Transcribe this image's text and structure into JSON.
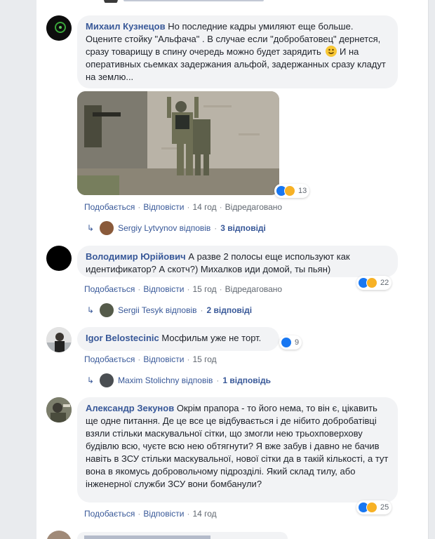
{
  "colors": {
    "link": "#385898",
    "meta": "#606770",
    "bubble": "#f2f3f5",
    "like": "#1877f2",
    "haha": "#f7b125"
  },
  "comments": [
    {
      "author": "Михаил Кузнецов",
      "text_1": "Но последние кадры умиляют еще больше. Оцените стойку \"Альфача\" . В случае если \"добробатовец\" дернется, сразу товарищу в спину очередь можно будет зарядить",
      "text_2": " И на оперативных сьемках задержания альфой, задержанных сразу кладут на землю...",
      "reactions": "13",
      "like": "Подобається",
      "reply": "Відповісти",
      "time": "14 год",
      "edited": "Відредаговано",
      "replies_by": "Sergiy Lytvynov відповів",
      "replies_count": "3 відповіді"
    },
    {
      "author": "Володимир Юрійович",
      "text": "А разве 2 полосы еще используют как идентификатор? А скотч?) Михалков иди домой, ты пьян)",
      "reactions": "22",
      "like": "Подобається",
      "reply": "Відповісти",
      "time": "15 год",
      "edited": "Відредаговано",
      "replies_by": "Sergii Tesyk відповів",
      "replies_count": "2 відповіді"
    },
    {
      "author": "Igor Belostecinic",
      "text": "Мосфильм уже не торт.",
      "reactions": "9",
      "like": "Подобається",
      "reply": "Відповісти",
      "time": "15 год",
      "replies_by": "Maxim Stolichny відповів",
      "replies_count": "1 відповідь"
    },
    {
      "author": "Александр Зекунов",
      "text": "Окрім прапора - то його нема, то він є, цікавить ще одне питання. Де це все це відбувається і де нібито добробатівці взяли стільки маскувальної сітки, що змогли нею трьохповерхову будівлю всю, чуєте всю нею обтягнути? Я вже забув і давно не бачив навіть в ЗСУ стільки маскувальної, нової сітки да в такій кількості, а тут вона в якомусь добровольчому підрозділі. Який склад тилу, або інженерної служби ЗСУ вони бомбанули?",
      "reactions": "25",
      "like": "Подобається",
      "reply": "Відповісти",
      "time": "14 год"
    }
  ]
}
